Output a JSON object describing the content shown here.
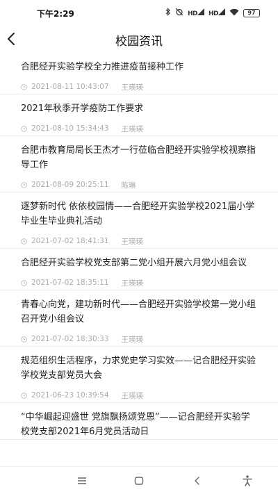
{
  "status": {
    "time": "下午2:29",
    "icons": [
      "bluetooth-icon",
      "alarm-off-icon",
      "signal-hd-icon",
      "signal-hd-icon",
      "wifi-icon",
      "battery-icon"
    ],
    "signal1": "HD",
    "signal2": "HD",
    "battery": "97"
  },
  "header": {
    "back_icon": "chevron-left-icon",
    "title": "校园资讯"
  },
  "news": [
    {
      "title": "合肥经开实验学校全力推进疫苗接种工作",
      "date": "2021-08-11 10:43:07",
      "author": "王瑛瑛"
    },
    {
      "title": "2021年秋季开学疫防工作要求",
      "date": "2021-08-10 15:34:43",
      "author": "王瑛瑛"
    },
    {
      "title": "合肥市教育局局长王杰才一行莅临合肥经开实验学校视察指导工作",
      "date": "2021-08-09 20:25:11",
      "author": "陈琳"
    },
    {
      "title": "逐梦新时代  依依校园情——合肥经开实验学校2021届小学毕业生毕业典礼活动",
      "date": "2021-07-02 18:41:31",
      "author": "王瑛瑛"
    },
    {
      "title": "合肥经开实验学校党支部第二党小组开展六月党小组会议",
      "date": "2021-07-02 18:35:11",
      "author": "王瑛瑛"
    },
    {
      "title": "青春心向党，建功新时代——合肥经开实验学校第一党小组召开党小组会议",
      "date": "2021-07-02 18:30:33",
      "author": "王瑛瑛"
    },
    {
      "title": "规范组织生活程序，力求党史学习实效——记合肥经开实验学校党支部党员大会",
      "date": "2021-06-23 10:39:54",
      "author": "王瑛瑛"
    },
    {
      "title": "“中华崛起迎盛世 党旗飘扬颂党恩”——记合肥经开实验学校党支部2021年6月党员活动日",
      "date": "",
      "author": ""
    }
  ],
  "bottom_nav": {
    "icons": [
      "menu-icon",
      "home-square-icon",
      "back-triangle-icon",
      "accessibility-icon"
    ]
  }
}
